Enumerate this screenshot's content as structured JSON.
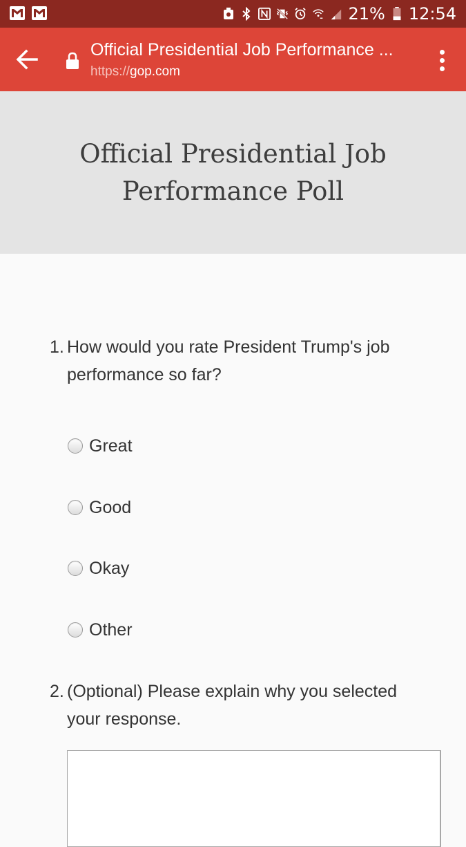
{
  "status_bar": {
    "battery": "21%",
    "time": "12:54",
    "icons": [
      "gmail-icon",
      "gmail-icon",
      "screenshot-icon",
      "bluetooth-icon",
      "nfc-icon",
      "vibrate-icon",
      "alarm-icon",
      "wifi-calling-icon",
      "signal-icon",
      "battery-icon"
    ]
  },
  "toolbar": {
    "title": "Official Presidential Job Performance ...",
    "url_scheme": "https://",
    "url_host": "gop.com"
  },
  "banner": {
    "title_line1": "Official Presidential Job",
    "title_line2": "Performance Poll"
  },
  "questions": [
    {
      "number": "1.",
      "text": "How would you rate President Trump's job performance so far?",
      "options": [
        "Great",
        "Good",
        "Okay",
        "Other"
      ]
    },
    {
      "number": "2.",
      "text": "(Optional) Please explain why you selected your response."
    }
  ],
  "colors": {
    "status_bar": "#8b2820",
    "toolbar": "#dd4538",
    "banner": "#e4e4e4",
    "background": "#fafafa"
  }
}
